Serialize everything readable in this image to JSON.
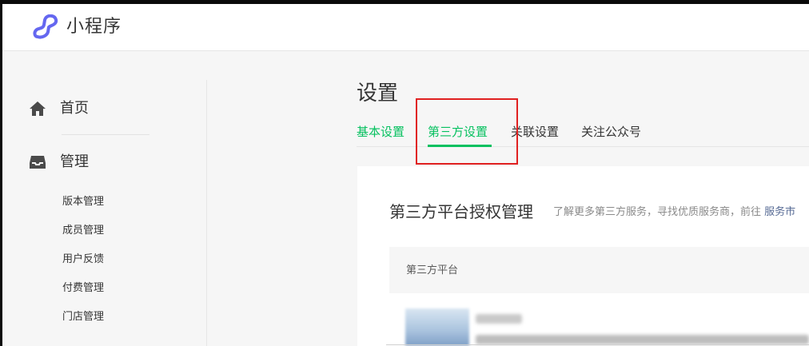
{
  "app": {
    "title": "小程序"
  },
  "sidebar": {
    "home_label": "首页",
    "manage_label": "管理",
    "sub_items": [
      {
        "label": "版本管理"
      },
      {
        "label": "成员管理"
      },
      {
        "label": "用户反馈"
      },
      {
        "label": "付费管理"
      },
      {
        "label": "门店管理"
      }
    ]
  },
  "main": {
    "title": "设置",
    "tabs": [
      {
        "label": "基本设置"
      },
      {
        "label": "第三方设置",
        "active": true
      },
      {
        "label": "关联设置"
      },
      {
        "label": "关注公众号"
      }
    ],
    "section": {
      "title": "第三方平台授权管理",
      "desc_prefix": "了解更多第三方服务，寻找优质服务商，前往",
      "desc_link": "服务市",
      "table_header": "第三方平台"
    }
  },
  "colors": {
    "accent_green": "#07c160",
    "highlight_red": "#e02020",
    "logo_purple": "#6467f0",
    "link_blue": "#576b95"
  },
  "icons": [
    "miniprogram-logo-icon",
    "home-icon",
    "inbox-icon"
  ]
}
